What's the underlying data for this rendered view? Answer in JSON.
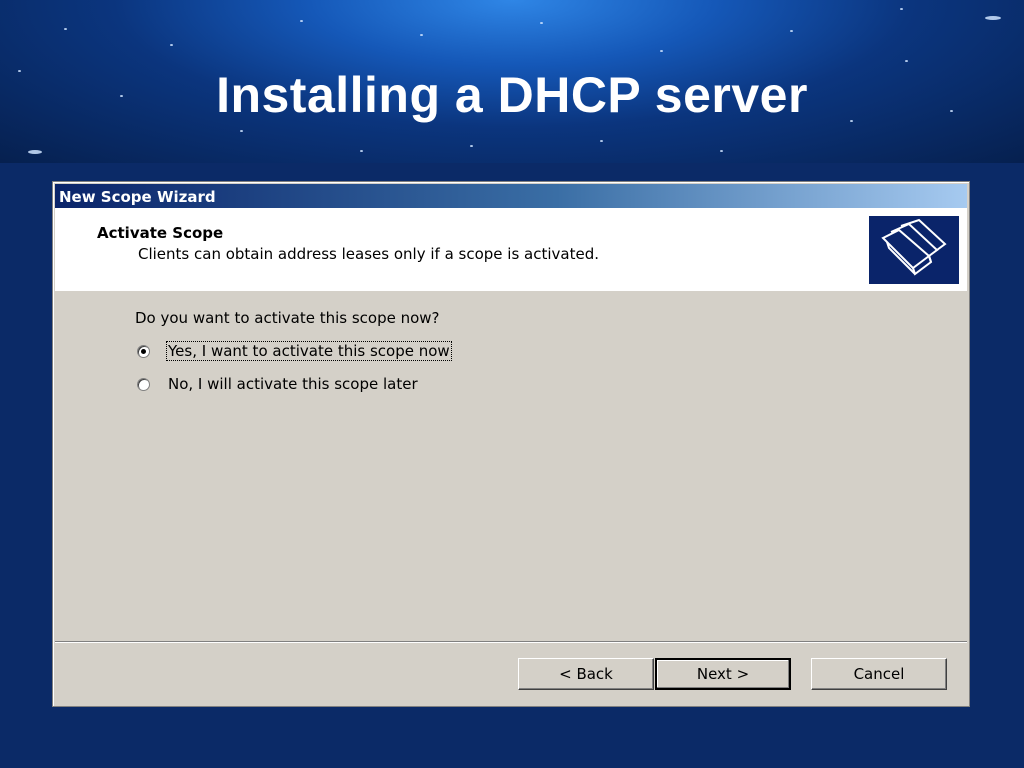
{
  "slide": {
    "title": "Installing a DHCP server"
  },
  "dialog": {
    "window_title": "New Scope Wizard",
    "header": {
      "title": "Activate Scope",
      "subtitle": "Clients can obtain address leases only if a scope is activated.",
      "icon": "folders-wizard-icon"
    },
    "question": "Do you want to activate this scope now?",
    "options": [
      {
        "label": "Yes, I want to activate this scope now",
        "checked": true
      },
      {
        "label": "No, I will activate this scope later",
        "checked": false
      }
    ],
    "buttons": {
      "back": "< Back",
      "next": "Next >",
      "cancel": "Cancel"
    }
  },
  "colors": {
    "slide_background": "#0b2a67",
    "titlebar_start": "#0a246a",
    "titlebar_end": "#a6caf0",
    "dialog_face": "#d4d0c8"
  }
}
